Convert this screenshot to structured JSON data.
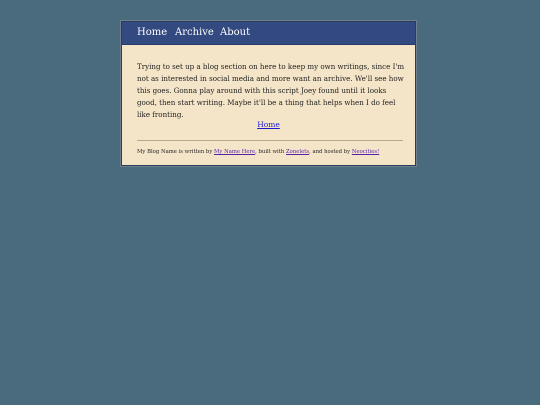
{
  "nav": {
    "home": "Home",
    "archive": "Archive",
    "about": "About"
  },
  "post": {
    "body": "Trying to set up a blog section on here to keep my own writings, since I'm not as interested in social media and more want an archive. We'll see how this goes. Gonna play around with this script Joey found until it looks good, then start writing. Maybe it'll be a thing that helps when I do feel like fronting."
  },
  "home_link": "Home",
  "footer": {
    "blog_name_text": "My Blog Name is written by ",
    "author_link": "My Name Here",
    "built_with_text": ", built with ",
    "zonelets_link": "Zonelets",
    "hosted_by_text": ", and hosted by ",
    "neocities_link": "Neocities!"
  },
  "colors": {
    "background": "#4a6b7e",
    "card": "#f5e5c8",
    "nav": "#334a80",
    "link": "#1a1acc",
    "visited_link": "#5522aa"
  }
}
